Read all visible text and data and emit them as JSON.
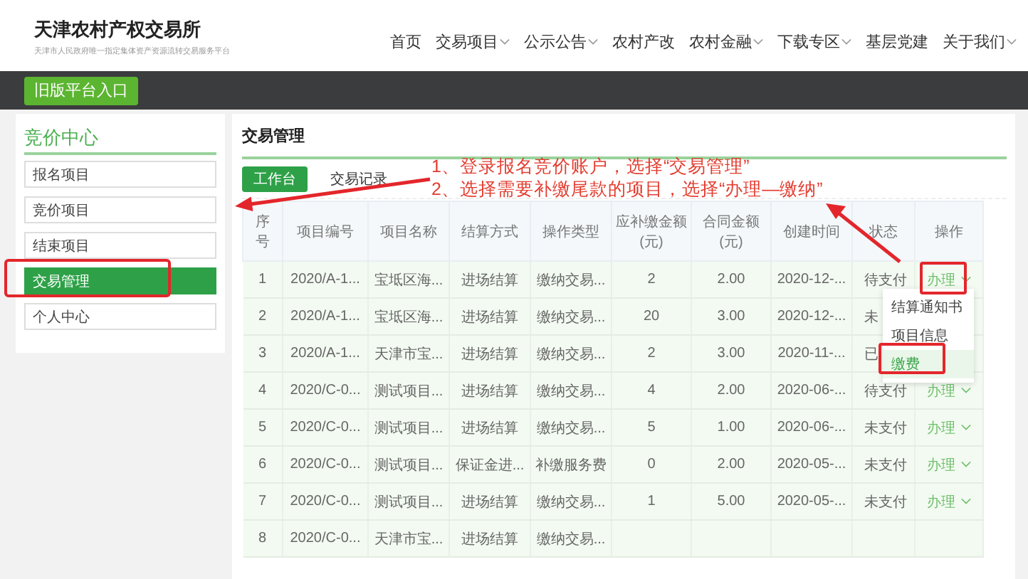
{
  "header": {
    "title": "天津农村产权交易所",
    "subtitle": "天津市人民政府唯一指定集体资产资源流转交易服务平台"
  },
  "nav": [
    {
      "label": "首页",
      "dropdown": false
    },
    {
      "label": "交易项目",
      "dropdown": true
    },
    {
      "label": "公示公告",
      "dropdown": true
    },
    {
      "label": "农村产改",
      "dropdown": false
    },
    {
      "label": "农村金融",
      "dropdown": true
    },
    {
      "label": "下载专区",
      "dropdown": true
    },
    {
      "label": "基层党建",
      "dropdown": false
    },
    {
      "label": "关于我们",
      "dropdown": true
    }
  ],
  "topbar": {
    "button": "旧版平台入口"
  },
  "sidebar": {
    "title": "竞价中心",
    "items": [
      {
        "label": "报名项目",
        "selected": false
      },
      {
        "label": "竞价项目",
        "selected": false
      },
      {
        "label": "结束项目",
        "selected": false
      },
      {
        "label": "交易管理",
        "selected": true
      },
      {
        "label": "个人中心",
        "selected": false
      }
    ]
  },
  "main": {
    "title": "交易管理",
    "tabs": [
      {
        "label": "工作台",
        "selected": true
      },
      {
        "label": "交易记录",
        "selected": false
      }
    ],
    "table": {
      "columns": [
        "序号",
        "项目编号",
        "项目名称",
        "结算方式",
        "操作类型",
        "应补缴金额(元)",
        "合同金额(元)",
        "创建时间",
        "状态",
        "操作"
      ],
      "rows": [
        {
          "cells": [
            "1",
            "2020/A-1...",
            "宝坻区海...",
            "进场结算",
            "缴纳交易...",
            "2",
            "2.00",
            "2020-12-...",
            "待支付"
          ],
          "action": "办理"
        },
        {
          "cells": [
            "2",
            "2020/A-1...",
            "宝坻区海...",
            "进场结算",
            "缴纳交易...",
            "20",
            "3.00",
            "2020-12-...",
            "未"
          ]
        },
        {
          "cells": [
            "3",
            "2020/A-1...",
            "天津市宝...",
            "进场结算",
            "缴纳交易...",
            "2",
            "3.00",
            "2020-11-...",
            "已"
          ]
        },
        {
          "cells": [
            "4",
            "2020/C-0...",
            "测试项目...",
            "进场结算",
            "缴纳交易...",
            "4",
            "2.00",
            "2020-06-...",
            "待支付"
          ],
          "action": "办理"
        },
        {
          "cells": [
            "5",
            "2020/C-0...",
            "测试项目...",
            "进场结算",
            "缴纳交易...",
            "5",
            "1.00",
            "2020-06-...",
            "未支付"
          ],
          "action": "办理"
        },
        {
          "cells": [
            "6",
            "2020/C-0...",
            "测试项目...",
            "保证金进...",
            "补缴服务费",
            "0",
            "2.00",
            "2020-05-...",
            "未支付"
          ],
          "action": "办理"
        },
        {
          "cells": [
            "7",
            "2020/C-0...",
            "测试项目...",
            "进场结算",
            "缴纳交易...",
            "1",
            "5.00",
            "2020-05-...",
            "未支付"
          ],
          "action": "办理"
        },
        {
          "cells": [
            "8",
            "2020/C-0...",
            "天津市宝...",
            "进场结算",
            "缴纳交易..."
          ]
        }
      ]
    },
    "menu": {
      "items": [
        {
          "label": "结算通知书",
          "selected": false
        },
        {
          "label": "项目信息",
          "selected": false
        },
        {
          "label": "缴费",
          "selected": true
        }
      ]
    }
  },
  "annotations": {
    "lines": [
      "1、登录报名竞价账户，选择“交易管理”",
      "2、选择需要补缴尾款的项目，选择“办理—缴纳”"
    ]
  }
}
